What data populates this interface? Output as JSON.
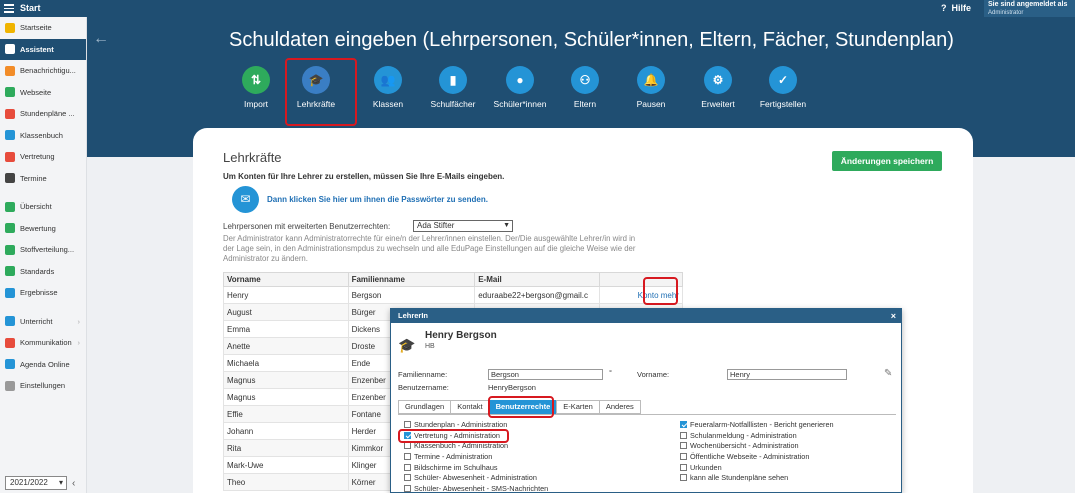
{
  "topbar": {
    "title": "Start",
    "help": "Hilfe",
    "user_line1": "Sie sind angemeldet als",
    "user_line2": "Administrator"
  },
  "sidebar": {
    "items": [
      {
        "label": "Startseite",
        "icon": "star-icon",
        "color": "#f0b400"
      },
      {
        "label": "Assistent",
        "icon": "wand-icon",
        "color": "#ffffff"
      },
      {
        "label": "Benachrichtigu...",
        "icon": "envelope-icon",
        "color": "#f28c28"
      },
      {
        "label": "Webseite",
        "icon": "globe-icon",
        "color": "#2eaa5c"
      },
      {
        "label": "Stundenpläne ...",
        "icon": "timetable-icon",
        "color": "#e74c3c"
      },
      {
        "label": "Klassenbuch",
        "icon": "book-icon",
        "color": "#2494d6"
      },
      {
        "label": "Vertretung",
        "icon": "person-icon",
        "color": "#e74c3c"
      },
      {
        "label": "Termine",
        "icon": "calendar-icon",
        "color": "#444444"
      },
      {
        "label": "Übersicht",
        "icon": "check-circle-icon",
        "color": "#2eaa5c"
      },
      {
        "label": "Bewertung",
        "icon": "grade-icon",
        "color": "#2eaa5c"
      },
      {
        "label": "Stoffverteilung...",
        "icon": "puzzle-icon",
        "color": "#2eaa5c"
      },
      {
        "label": "Standards",
        "icon": "shield-icon",
        "color": "#2eaa5c"
      },
      {
        "label": "Ergebnisse",
        "icon": "chart-icon",
        "color": "#2494d6"
      },
      {
        "label": "Unterricht",
        "icon": "layers-icon",
        "color": "#2494d6"
      },
      {
        "label": "Kommunikation",
        "icon": "chat-icon",
        "color": "#e74c3c"
      },
      {
        "label": "Agenda Online",
        "icon": "agenda-icon",
        "color": "#2494d6"
      },
      {
        "label": "Einstellungen",
        "icon": "gear-icon",
        "color": "#999999"
      }
    ],
    "year": "2021/2022"
  },
  "page": {
    "title": "Schuldaten eingeben (Lehrpersonen, Schüler*innen, Eltern, Fächer, Stundenplan)"
  },
  "steps": [
    {
      "label": "Import",
      "glyph": "⇅",
      "icon": "import-icon",
      "status": "done"
    },
    {
      "label": "Lehrkräfte",
      "glyph": "🎓",
      "icon": "graduation-cap-icon",
      "status": "current"
    },
    {
      "label": "Klassen",
      "glyph": "👥",
      "icon": "group-icon",
      "status": "todo"
    },
    {
      "label": "Schulfächer",
      "glyph": "▮",
      "icon": "book-icon",
      "status": "todo"
    },
    {
      "label": "Schüler*innen",
      "glyph": "●",
      "icon": "user-icon",
      "status": "todo"
    },
    {
      "label": "Eltern",
      "glyph": "⚇",
      "icon": "parents-icon",
      "status": "todo"
    },
    {
      "label": "Pausen",
      "glyph": "🔔",
      "icon": "bell-icon",
      "status": "todo"
    },
    {
      "label": "Erweitert",
      "glyph": "⚙",
      "icon": "gear-icon",
      "status": "todo"
    },
    {
      "label": "Fertigstellen",
      "glyph": "✓",
      "icon": "check-icon",
      "status": "todo"
    }
  ],
  "main": {
    "heading": "Lehrkräfte",
    "intro": "Um Konten für Ihre Lehrer zu erstellen, müssen Sie Ihre E-Mails eingeben.",
    "pw_link": "Dann klicken Sie hier um ihnen die Passwörter zu senden.",
    "save": "Änderungen speichern",
    "ext_label": "Lehrpersonen mit erweiterten Benutzerrechten:",
    "ext_value": "Ada Stifter",
    "admin_note": "Der Administrator kann Administratorrechte für eine/n der Lehrer/innen einstellen. Der/Die ausgewählte Lehrer/in wird in der Lage sein, in den Administrationsmpdus zu wechseln und alle EduPage Einstellungen auf die gleiche Weise wie der Administrator zu ändern."
  },
  "table": {
    "headers": [
      "Vorname",
      "Familienname",
      "E-Mail",
      ""
    ],
    "rows": [
      {
        "first": "Henry",
        "last": "Bergson",
        "email": "eduraabe22+bergson@gmail.c",
        "k": "Konto",
        "m": "mehr"
      },
      {
        "first": "August",
        "last": "Bürger",
        "email": "",
        "k": "",
        "m": ""
      },
      {
        "first": "Emma",
        "last": "Dickens",
        "email": "",
        "k": "",
        "m": ""
      },
      {
        "first": "Anette",
        "last": "Droste",
        "email": "",
        "k": "",
        "m": ""
      },
      {
        "first": "Michaela",
        "last": "Ende",
        "email": "",
        "k": "",
        "m": ""
      },
      {
        "first": "Magnus",
        "last": "Enzenber",
        "email": "",
        "k": "",
        "m": ""
      },
      {
        "first": "Magnus",
        "last": "Enzenber",
        "email": "",
        "k": "",
        "m": ""
      },
      {
        "first": "Effie",
        "last": "Fontane",
        "email": "",
        "k": "",
        "m": ""
      },
      {
        "first": "Johann",
        "last": "Herder",
        "email": "",
        "k": "",
        "m": ""
      },
      {
        "first": "Rita",
        "last": "Kimmkor",
        "email": "",
        "k": "",
        "m": ""
      },
      {
        "first": "Mark-Uwe",
        "last": "Klinger",
        "email": "",
        "k": "",
        "m": ""
      },
      {
        "first": "Theo",
        "last": "Körner",
        "email": "",
        "k": "",
        "m": ""
      }
    ]
  },
  "dialog": {
    "title": "LehrerIn",
    "close": "×",
    "name": "Henry Bergson",
    "initials": "HB",
    "familienname_label": "Familienname:",
    "familienname_value": "Bergson",
    "degree": "°",
    "vorname_label": "Vorname:",
    "vorname_value": "Henry",
    "benutzername_label": "Benutzername:",
    "benutzername_value": "HenryBergson",
    "tabs": [
      "Grundlagen",
      "Kontakt",
      "Benutzerrechte",
      "E-Karten",
      "Anderes"
    ],
    "perms_left": [
      {
        "label": "Stundenplan - Administration",
        "checked": false
      },
      {
        "label": "Vertretung - Administration",
        "checked": true
      },
      {
        "label": "Klassenbuch - Administration",
        "checked": false
      },
      {
        "label": "Termine - Administration",
        "checked": false
      },
      {
        "label": "Bildschirme im Schulhaus",
        "checked": false
      },
      {
        "label": "Schüler- Abwesenheit - Administration",
        "checked": false
      },
      {
        "label": "Schüler- Abwesenheit - SMS-Nachrichten",
        "checked": false
      }
    ],
    "perms_right": [
      {
        "label": "Feueralarm-Notfalllisten - Bericht generieren",
        "checked": true
      },
      {
        "label": "Schulanmeldung - Administration",
        "checked": false
      },
      {
        "label": "Wochenübersicht - Administration",
        "checked": false
      },
      {
        "label": "Öffentliche Webseite - Administration",
        "checked": false
      },
      {
        "label": "Urkunden",
        "checked": false
      },
      {
        "label": "kann alle Stundenpläne sehen",
        "checked": false
      }
    ]
  },
  "colors": {
    "navy": "#1f4e72",
    "accent": "#2494d6",
    "green": "#2eaa5c",
    "highlight": "#d71920"
  }
}
